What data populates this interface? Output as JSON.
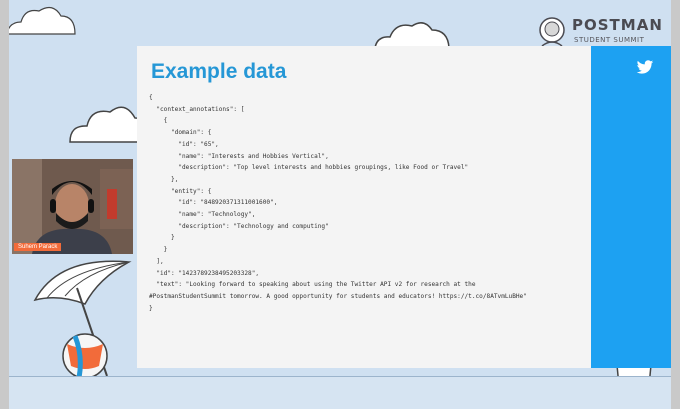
{
  "branding": {
    "logo_text": "POSTMAN",
    "logo_subtext": "STUDENT SUMMIT"
  },
  "slide": {
    "title": "Example data",
    "code_lines": [
      "{",
      "  \"context_annotations\": [",
      "    {",
      "      \"domain\": {",
      "        \"id\": \"65\",",
      "        \"name\": \"Interests and Hobbies Vertical\",",
      "        \"description\": \"Top level interests and hobbies groupings, like Food or Travel\"",
      "      },",
      "      \"entity\": {",
      "        \"id\": \"848920371311001600\",",
      "        \"name\": \"Technology\",",
      "        \"description\": \"Technology and computing\"",
      "      }",
      "    }",
      "  ],",
      "  \"id\": \"1423789238495203328\",",
      "  \"text\": \"Looking forward to speaking about using the Twitter API v2 for research at the",
      "#PostmanStudentSummit tomorrow. A good opportunity for students and educators! https://t.co/8ATvmLuBHe\"",
      "}"
    ]
  },
  "speaker": {
    "name": "Suhem Parack"
  },
  "icons": {
    "twitter": "twitter-bird-icon",
    "logo": "postman-astronaut-icon"
  },
  "colors": {
    "title": "#2597d6",
    "twitter_bar": "#1da1f2",
    "background": "#cfe0f1",
    "name_tag": "#f26b3a"
  }
}
